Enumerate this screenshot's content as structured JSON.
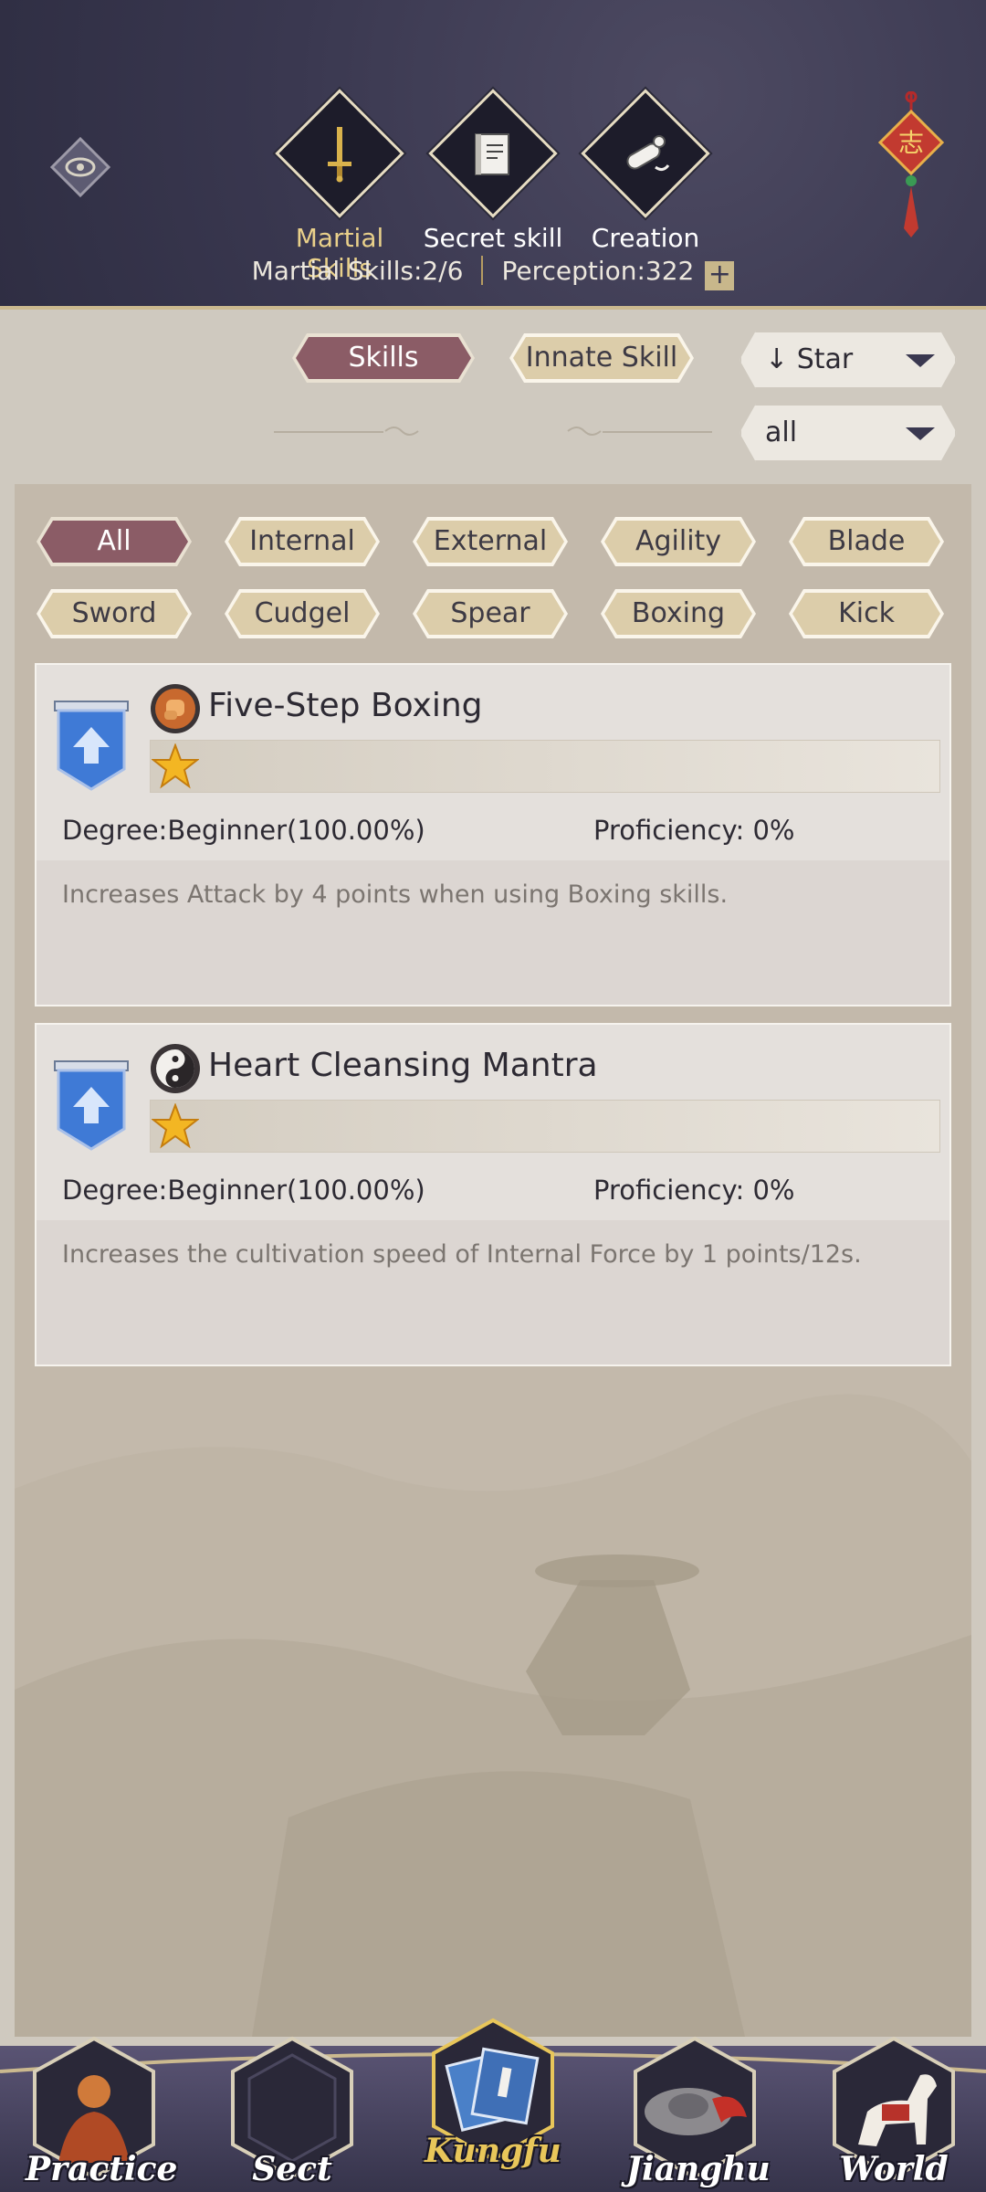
{
  "header": {
    "tabs": [
      {
        "label": "Martial Skills",
        "icon": "sword-icon",
        "active": true
      },
      {
        "label": "Secret skill",
        "icon": "book-icon",
        "active": false
      },
      {
        "label": "Creation",
        "icon": "scroll-icon",
        "active": false
      }
    ],
    "stats": {
      "martial_skills": "Martial Skills:2/6",
      "perception": "Perception:322",
      "plus": "+"
    },
    "charm_char": "志"
  },
  "filters": {
    "skills_tab": "Skills",
    "innate_tab": "Innate Skill",
    "sort": {
      "value": "Star",
      "arrow": "↓"
    },
    "type": {
      "value": "all"
    }
  },
  "categories": [
    "All",
    "Internal",
    "External",
    "Agility",
    "Blade",
    "Sword",
    "Cudgel",
    "Spear",
    "Boxing",
    "Kick"
  ],
  "skills": [
    {
      "name": "Five-Step Boxing",
      "stars": 1,
      "degree": "Degree:Beginner(100.00%)",
      "proficiency": "Proficiency: 0%",
      "description": "Increases Attack by 4 points when using Boxing skills.",
      "icon": "fist-icon"
    },
    {
      "name": "Heart Cleansing Mantra",
      "stars": 1,
      "degree": "Degree:Beginner(100.00%)",
      "proficiency": "Proficiency: 0%",
      "description": "Increases the cultivation speed of Internal Force by 1 points/12s.",
      "icon": "yin-yang-icon"
    }
  ],
  "nav": [
    {
      "label": "Practice",
      "active": false
    },
    {
      "label": "Sect",
      "active": false
    },
    {
      "label": "Kungfu",
      "active": true
    },
    {
      "label": "Jianghu",
      "active": false
    },
    {
      "label": "World",
      "active": false
    }
  ],
  "colors": {
    "header_bg": "#3a3850",
    "active_tab_text": "#e9d08a",
    "selected_pill": "#8b5c66",
    "unselected_pill": "#dccdaa",
    "panel_bg": "#c3b9ab",
    "card_bg": "#e4e0dc",
    "badge_blue": "#3f7ad6"
  }
}
